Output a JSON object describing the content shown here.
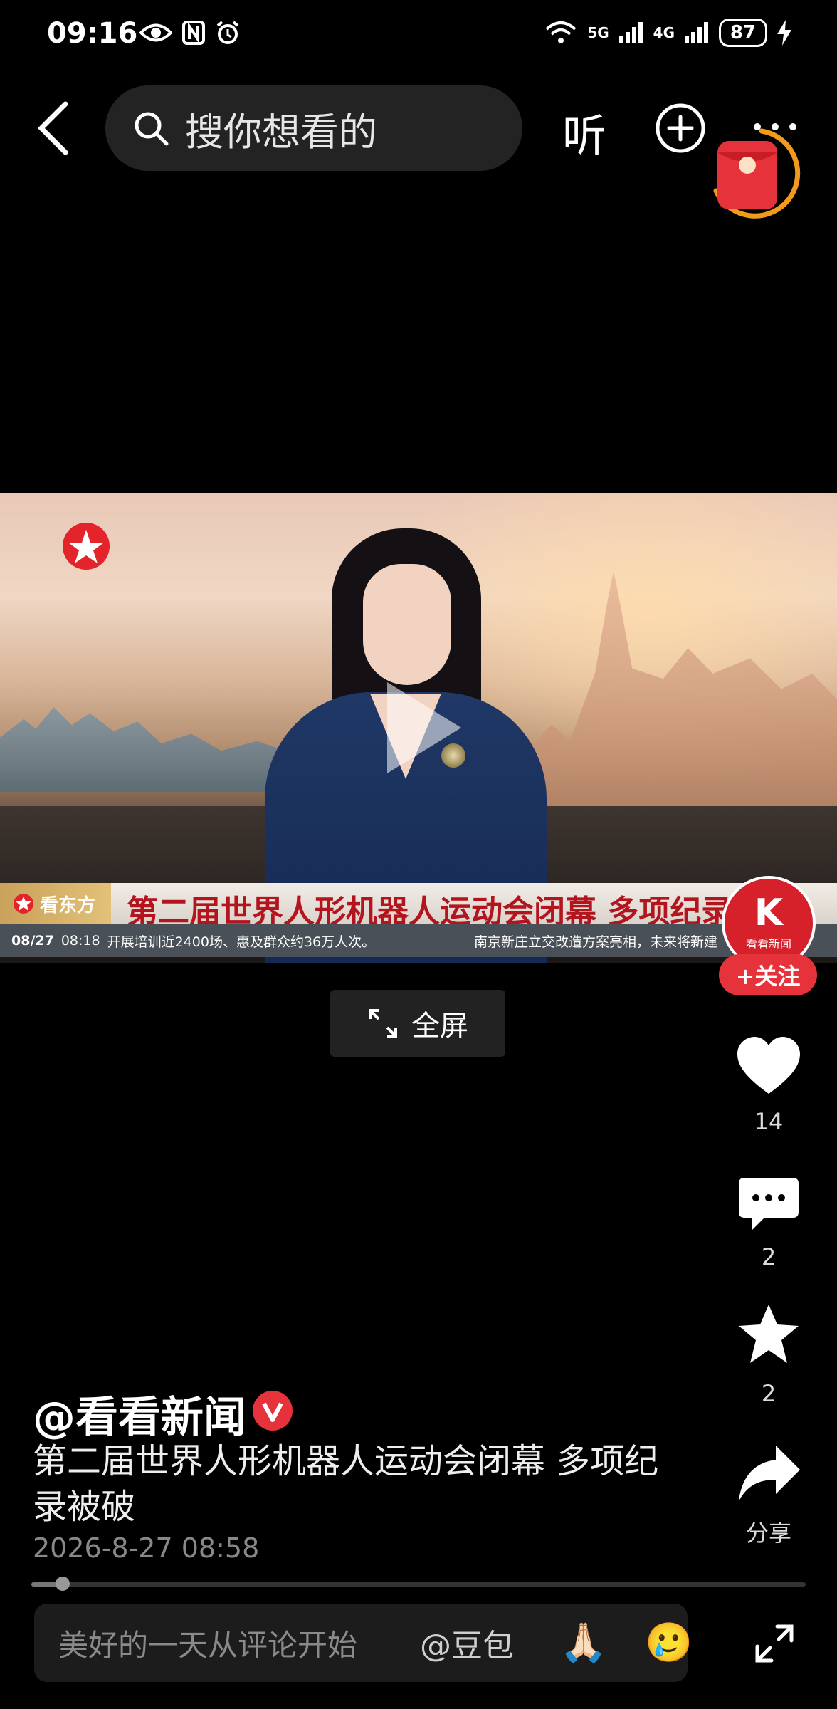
{
  "status_bar": {
    "time": "09:16",
    "network_1": "5G",
    "network_2": "4G",
    "battery": "87",
    "icons": [
      "eye-icon",
      "nfc-icon",
      "alarm-icon",
      "wifi-icon",
      "signal-icon",
      "charging-icon"
    ]
  },
  "top_nav": {
    "search_placeholder": "搜你想看的",
    "listen_label": "听"
  },
  "video": {
    "headline": "第二届世界人形机器人运动会闭幕 多项纪录被破",
    "channel_badge": "看东方",
    "ticker_date": "08/27",
    "ticker_time": "08:18",
    "ticker_left": "开展培训近2400场、惠及群众约36万人次。",
    "ticker_right": "南京新庄立交改造方案亮相，未来将新建"
  },
  "fullscreen": {
    "label": "全屏"
  },
  "side_rail": {
    "avatar_text": "看看新闻",
    "follow_label": "+关注",
    "likes": "14",
    "comments": "2",
    "favorites": "2",
    "share_label": "分享"
  },
  "post": {
    "author": "@看看新闻",
    "title": "第二届世界人形机器人运动会闭幕 多项纪录被破",
    "time": "2026-8-27 08:58",
    "progress": 0.04
  },
  "comment_bar": {
    "placeholder": "美好的一天从评论开始",
    "mention": "@豆包",
    "emoji_1": "🙏🏻",
    "emoji_2": "🥲"
  },
  "colors": {
    "accent_red": "#e5323b",
    "headline_red": "#b3141e",
    "redpacket_ring": "#f39a1d"
  }
}
